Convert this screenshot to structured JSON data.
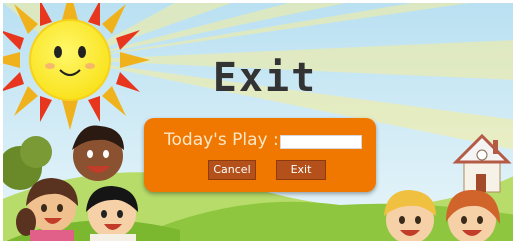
{
  "screen": {
    "title": "Exit"
  },
  "dialog": {
    "label": "Today's Play :",
    "input_value": "",
    "cancel_label": "Cancel",
    "exit_label": "Exit"
  },
  "colors": {
    "sky": "#cfe9f4",
    "sun": "#fdf035",
    "sun_rays": "#e8361e",
    "grass": "#8ec63f",
    "dialog_bg": "#f07800",
    "button_bg": "#b4501a",
    "title_text": "#333333"
  },
  "icons": [
    "sun-illustration",
    "house-illustration",
    "kids-illustration"
  ]
}
